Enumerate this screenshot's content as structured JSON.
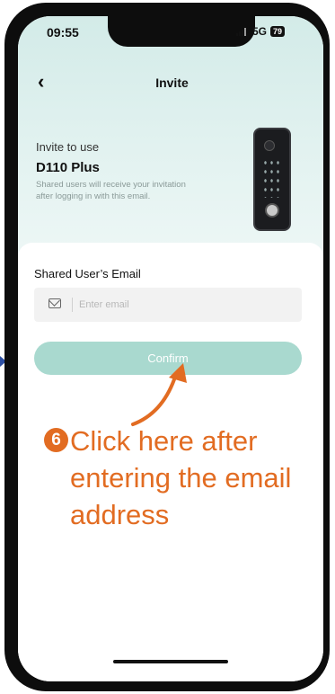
{
  "status_bar": {
    "time": "09:55",
    "network": "5G",
    "battery": "79"
  },
  "header": {
    "title": "Invite",
    "back_icon": "chevron-left-icon"
  },
  "hero": {
    "invite_label": "Invite to use",
    "device_name": "D110 Plus",
    "description": "Shared users will receive your invitation after logging in with this email."
  },
  "form": {
    "email_label": "Shared User’s Email",
    "email_placeholder": "Enter email",
    "email_value": "",
    "mail_icon": "mail-icon",
    "confirm_label": "Confirm"
  },
  "annotation": {
    "step": "6",
    "text": "Click here after entering the email address",
    "color": "#e26c22"
  },
  "colors": {
    "accent": "#a9d9cf",
    "hero_bg": "#d3ebe8",
    "annotation": "#e26c22"
  }
}
